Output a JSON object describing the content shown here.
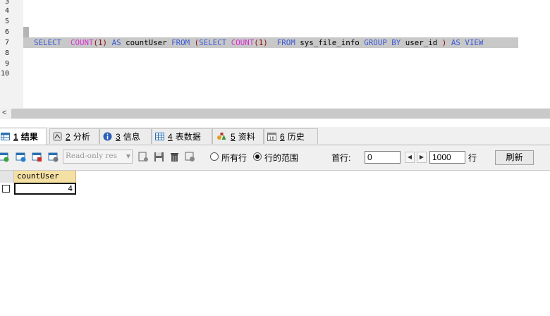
{
  "editor": {
    "line_numbers": [
      "3",
      "4",
      "5",
      "6",
      "7",
      "8",
      "9",
      "10"
    ],
    "sql_tokens": [
      {
        "t": "SELECT",
        "c": "kw"
      },
      {
        "t": "  ",
        "c": "pl"
      },
      {
        "t": "COUNT",
        "c": "fn"
      },
      {
        "t": "(1)",
        "c": "br"
      },
      {
        "t": " ",
        "c": "pl"
      },
      {
        "t": "AS",
        "c": "kw"
      },
      {
        "t": " countUser ",
        "c": "pl"
      },
      {
        "t": "FROM",
        "c": "kw"
      },
      {
        "t": " ",
        "c": "pl"
      },
      {
        "t": "(",
        "c": "br"
      },
      {
        "t": "SELECT",
        "c": "kw"
      },
      {
        "t": " ",
        "c": "pl"
      },
      {
        "t": "COUNT",
        "c": "fn"
      },
      {
        "t": "(1)",
        "c": "br"
      },
      {
        "t": "  ",
        "c": "pl"
      },
      {
        "t": "FROM",
        "c": "kw"
      },
      {
        "t": " sys_file_info ",
        "c": "pl"
      },
      {
        "t": "GROUP BY",
        "c": "kw"
      },
      {
        "t": " user_id ",
        "c": "pl"
      },
      {
        "t": ")",
        "c": "br"
      },
      {
        "t": " ",
        "c": "pl"
      },
      {
        "t": "AS",
        "c": "kw"
      },
      {
        "t": " ",
        "c": "pl"
      },
      {
        "t": "VIEW",
        "c": "kw"
      }
    ],
    "scroll_left_glyph": "<"
  },
  "tabs": [
    {
      "num": "1",
      "label": "结果",
      "icon": "result-grid-icon",
      "active": true
    },
    {
      "num": "2",
      "label": "分析",
      "icon": "profiler-icon",
      "active": false
    },
    {
      "num": "3",
      "label": "信息",
      "icon": "info-icon",
      "active": false
    },
    {
      "num": "4",
      "label": "表数据",
      "icon": "table-data-icon",
      "active": false
    },
    {
      "num": "5",
      "label": "资料",
      "icon": "shapes-icon",
      "active": false
    },
    {
      "num": "6",
      "label": "历史",
      "icon": "calendar-icon",
      "active": false
    }
  ],
  "toolbar": {
    "mode_value": "Read-only res",
    "radio_all_label": "所有行",
    "radio_range_label": "行的范围",
    "first_row_label": "首行:",
    "first_row_value": "0",
    "rows_value": "1000",
    "rows_label": "行",
    "refresh_label": "刷新",
    "prev_glyph": "◀",
    "next_glyph": "▶",
    "dropdown_glyph": "▼",
    "selected_radio": "range"
  },
  "grid": {
    "columns": [
      "countUser"
    ],
    "rows": [
      [
        "4"
      ]
    ]
  },
  "colors": {
    "keyword": "#3b5bd6",
    "function": "#d92fd1",
    "bracket": "#8b0a0a",
    "header_bg": "#f5e0a4"
  }
}
